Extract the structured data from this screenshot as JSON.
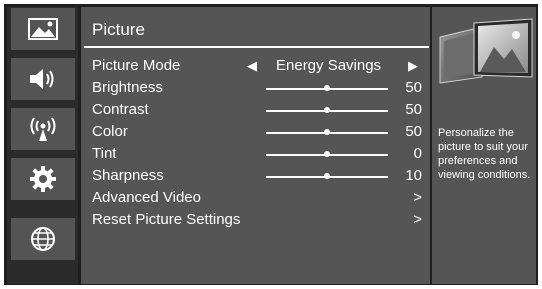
{
  "sidebar": {
    "icons": [
      {
        "name": "picture-icon"
      },
      {
        "name": "sound-icon"
      },
      {
        "name": "broadcast-icon"
      },
      {
        "name": "settings-gear-icon"
      },
      {
        "name": "network-globe-icon"
      }
    ]
  },
  "menu": {
    "title": "Picture",
    "picture_mode": {
      "label": "Picture Mode",
      "value": "Energy Savings",
      "left_arrow": "◀",
      "right_arrow": "▶"
    },
    "settings": [
      {
        "label": "Brightness",
        "value": "50",
        "level": 0.5
      },
      {
        "label": "Contrast",
        "value": "50",
        "level": 0.5
      },
      {
        "label": "Color",
        "value": "50",
        "level": 0.5
      },
      {
        "label": "Tint",
        "value": "0",
        "level": 0.5
      },
      {
        "label": "Sharpness",
        "value": "10",
        "level": 0.5
      }
    ],
    "links": [
      {
        "label": "Advanced Video",
        "arrow": ">"
      },
      {
        "label": "Reset Picture Settings",
        "arrow": ">"
      }
    ]
  },
  "help": {
    "text": "Personalize the picture to suit your preferences and viewing conditions."
  }
}
